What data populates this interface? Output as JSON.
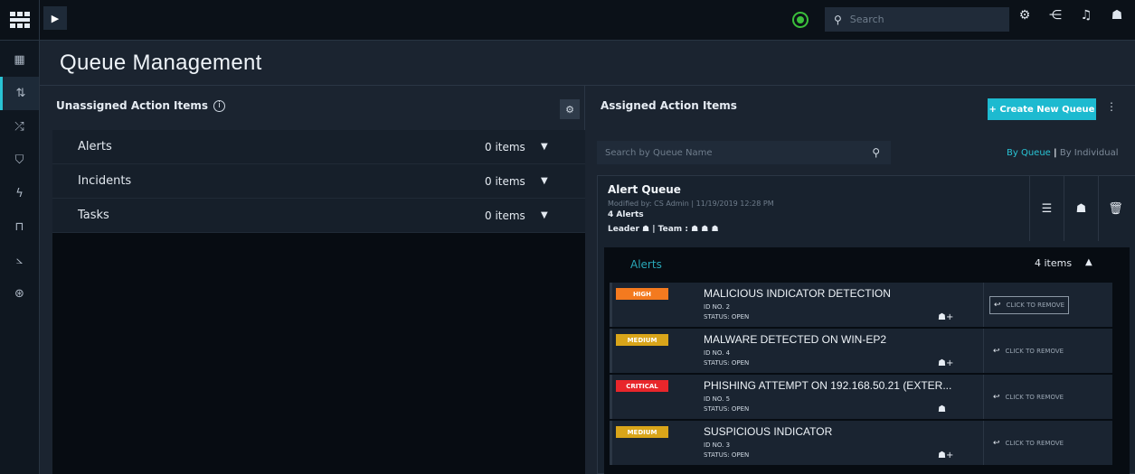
{
  "topbar": {
    "search_placeholder": "Search"
  },
  "page": {
    "title": "Queue Management"
  },
  "unassigned": {
    "title": "Unassigned Action Items",
    "rows": [
      {
        "label": "Alerts",
        "count": "0 items"
      },
      {
        "label": "Incidents",
        "count": "0 items"
      },
      {
        "label": "Tasks",
        "count": "0 items"
      }
    ]
  },
  "assigned": {
    "title": "Assigned Action Items",
    "create_label": "+ Create New Queue",
    "search_placeholder": "Search by Queue Name",
    "view_by_queue": "By Queue",
    "view_separator": "|",
    "view_by_individual": "By Individual",
    "queue": {
      "name": "Alert Queue",
      "modified": "Modified by: CS Admin | 11/19/2019 12:28 PM",
      "alert_count": "4 Alerts",
      "leader_label": "Leader",
      "team_label": "| Team :",
      "section_label": "Alerts",
      "section_count": "4 items",
      "alerts": [
        {
          "severity": "HIGH",
          "severity_color": "#f47a1f",
          "title": "MALICIOUS INDICATOR DETECTION",
          "id": "ID NO. 2",
          "status": "STATUS: OPEN",
          "remove": "CLICK TO REMOVE",
          "user_icon": "add-user-icon"
        },
        {
          "severity": "MEDIUM",
          "severity_color": "#d9a51a",
          "title": "MALWARE DETECTED ON WIN-EP2",
          "id": "ID NO. 4",
          "status": "STATUS: OPEN",
          "remove": "CLICK TO REMOVE",
          "user_icon": "add-user-icon"
        },
        {
          "severity": "CRITICAL",
          "severity_color": "#e8262b",
          "title": "PHISHING ATTEMPT ON 192.168.50.21 (EXTER...",
          "id": "ID NO. 5",
          "status": "STATUS: OPEN",
          "remove": "CLICK TO REMOVE",
          "user_icon": "user-icon"
        },
        {
          "severity": "MEDIUM",
          "severity_color": "#d9a51a",
          "title": "SUSPICIOUS INDICATOR",
          "id": "ID NO. 3",
          "status": "STATUS: OPEN",
          "remove": "CLICK TO REMOVE",
          "user_icon": "add-user-icon"
        }
      ]
    }
  },
  "colors": {
    "accent": "#1dbad0",
    "status_online": "#3bbf3b"
  }
}
